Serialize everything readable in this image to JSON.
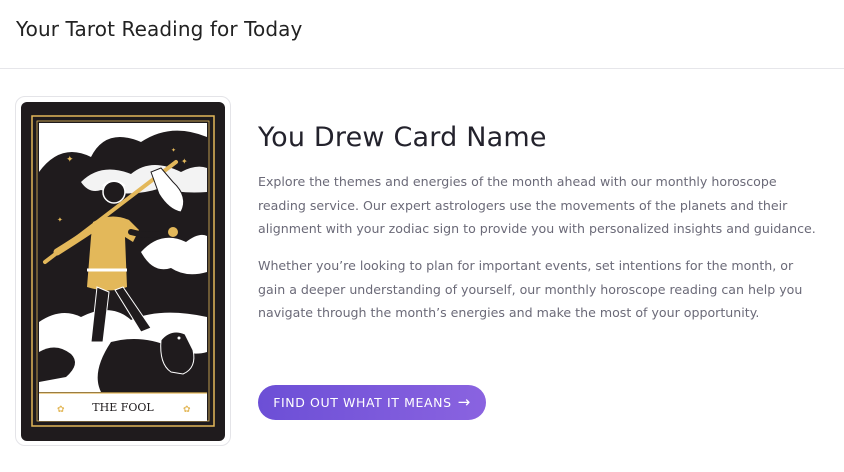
{
  "header": {
    "title": "Your Tarot Reading for Today"
  },
  "card": {
    "name": "THE FOOL",
    "colors": {
      "background": "#1f1b1d",
      "gold": "#e3b85a",
      "white": "#ffffff"
    }
  },
  "main": {
    "heading": "You Drew Card Name",
    "paragraph1": "Explore the themes and energies of the month ahead with our monthly horoscope reading service. Our expert astrologers use the movements of the planets and their alignment with your zodiac sign to provide you with personalized insights and guidance.",
    "paragraph2": "Whether you’re looking to plan for important events, set intentions for the month, or gain a deeper understanding of yourself, our monthly horoscope reading can help you navigate through the month’s energies and make the most of your opportunity.",
    "cta_label": "FIND OUT WHAT IT MEANS",
    "cta_icon": "arrow-right-icon"
  },
  "colors": {
    "accent_start": "#6c4fd6",
    "accent_end": "#8a63e0",
    "text_muted": "#6b6a78"
  }
}
